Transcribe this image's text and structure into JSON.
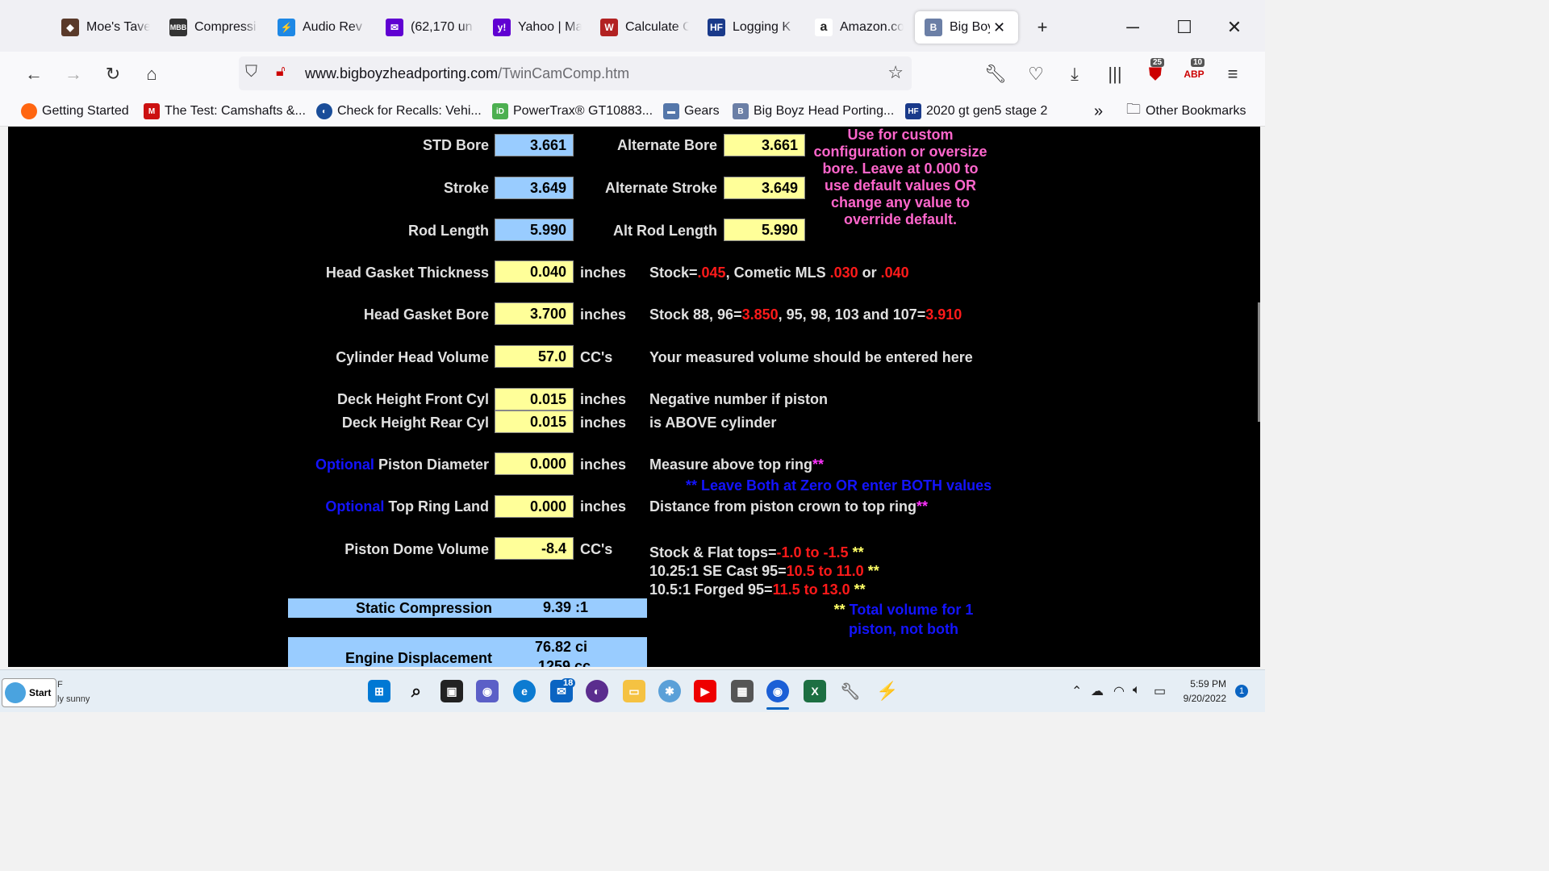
{
  "browser": {
    "tabs": [
      {
        "label": "Moe's Tave",
        "icon": "shield-icon",
        "color": "#5a3a2a"
      },
      {
        "label": "Compressi",
        "icon": "mbb-logo-icon",
        "color": "#333333"
      },
      {
        "label": "Audio Rev",
        "icon": "bolt-icon",
        "color": "#1e88e5"
      },
      {
        "label": "(62,170 un",
        "icon": "mail-icon",
        "color": "#6001d2"
      },
      {
        "label": "Yahoo | Ma",
        "icon": "yahoo-icon",
        "color": "#6001d2"
      },
      {
        "label": "Calculate C",
        "icon": "wings-icon",
        "color": "#b22222"
      },
      {
        "label": "Logging K",
        "icon": "hf-logo-icon",
        "color": "#1a3a8a"
      },
      {
        "label": "Amazon.co",
        "icon": "amazon-icon",
        "color": "#222222"
      },
      {
        "label": "Big Boy",
        "icon": "bigboyz-icon",
        "color": "#6b7fa6"
      }
    ],
    "active_tab_index": 8,
    "url_domain": "www.bigboyzheadporting.com",
    "url_path": "/TwinCamComp.htm",
    "badge_ublock": "25",
    "badge_abp": "10",
    "bookmarks": [
      {
        "label": "Getting Started",
        "icon": "firefox-icon",
        "color": "#ff6611"
      },
      {
        "label": "The Test: Camshafts &...",
        "icon": "m360-icon",
        "color": "#cc1111"
      },
      {
        "label": "Check for Recalls: Vehi...",
        "icon": "globe-icon",
        "color": "#1a4d99"
      },
      {
        "label": "PowerTrax® GT10883...",
        "icon": "id-icon",
        "color": "#4caf50"
      },
      {
        "label": "Gears",
        "icon": "car-icon",
        "color": "#5577aa"
      },
      {
        "label": "Big Boyz Head Porting...",
        "icon": "bigboyz-icon",
        "color": "#6b7fa6"
      },
      {
        "label": "2020 gt gen5 stage 2",
        "icon": "hf-logo-icon",
        "color": "#1a3a8a"
      }
    ],
    "other_bookmarks": "Other Bookmarks"
  },
  "calc": {
    "std_bore": {
      "label": "STD Bore",
      "value": "3.661"
    },
    "alt_bore": {
      "label": "Alternate Bore",
      "value": "3.661"
    },
    "stroke": {
      "label": "Stroke",
      "value": "3.649"
    },
    "alt_stroke": {
      "label": "Alternate Stroke",
      "value": "3.649"
    },
    "rod_length": {
      "label": "Rod Length",
      "value": "5.990"
    },
    "alt_rod_length": {
      "label": "Alt Rod Length",
      "value": "5.990"
    },
    "custom_note": "Use for custom configuration or oversize bore.  Leave at 0.000 to use default values OR change any value to override default.",
    "head_gasket_thickness": {
      "label": "Head Gasket Thickness",
      "value": "0.040",
      "unit": "inches"
    },
    "gasket_note": {
      "a": "Stock=",
      "b": ".045",
      "c": ", Cometic MLS  ",
      "d": ".030",
      "e": "  or  ",
      "f": ".040"
    },
    "head_gasket_bore": {
      "label": "Head Gasket Bore",
      "value": "3.700",
      "unit": "inches"
    },
    "bore_note": {
      "a": "Stock 88, 96=",
      "b": "3.850",
      "c": ", 95, 98, 103 and 107=",
      "d": "3.910"
    },
    "cyl_head_volume": {
      "label": "Cylinder Head Volume",
      "value": "57.0",
      "unit": "CC's"
    },
    "volume_note": "Your measured volume should be entered here",
    "deck_front": {
      "label": "Deck Height Front Cyl",
      "value": "0.015",
      "unit": "inches"
    },
    "deck_rear": {
      "label": "Deck Height Rear Cyl",
      "value": "0.015",
      "unit": "inches"
    },
    "deck_note_1": "Negative number if piston",
    "deck_note_2": "is ABOVE cylinder",
    "optional": "Optional",
    "piston_diameter": {
      "label": "Piston Diameter",
      "value": "0.000",
      "unit": "inches"
    },
    "piston_note": "Measure above top ring",
    "stars": "**",
    "leave_both_note": "** Leave Both at Zero OR enter BOTH values",
    "top_ring_land": {
      "label": "Top Ring Land",
      "value": "0.000",
      "unit": "inches"
    },
    "ring_note": "Distance from piston crown to top ring",
    "piston_dome_volume": {
      "label": "Piston Dome Volume",
      "value": "-8.4",
      "unit": "CC's"
    },
    "dome_note_1": {
      "a": "Stock & Flat tops=",
      "b": "-1.0 to -1.5",
      "c": " **"
    },
    "dome_note_2": {
      "a": "10.25:1 SE Cast 95=",
      "b": "10.5 to 11.0",
      "c": " **"
    },
    "dome_note_3": {
      "a": "10.5:1 Forged 95=",
      "b": "11.5 to 13.0",
      "c": " **"
    },
    "total_volume_note": "Total volume for 1 piston, not both",
    "static_compression": {
      "label": "Static Compression",
      "value": "9.39 :1"
    },
    "engine_displacement": {
      "label": "Engine Displacement",
      "value_ci": "76.82 ci",
      "value_cc": "1259 cc"
    }
  },
  "taskbar": {
    "start_label": "Start",
    "weather_line1": "F",
    "weather_line2": "ly sunny",
    "mail_badge": "18",
    "time": "5:59 PM",
    "date": "9/20/2022",
    "notification_count": "1"
  }
}
